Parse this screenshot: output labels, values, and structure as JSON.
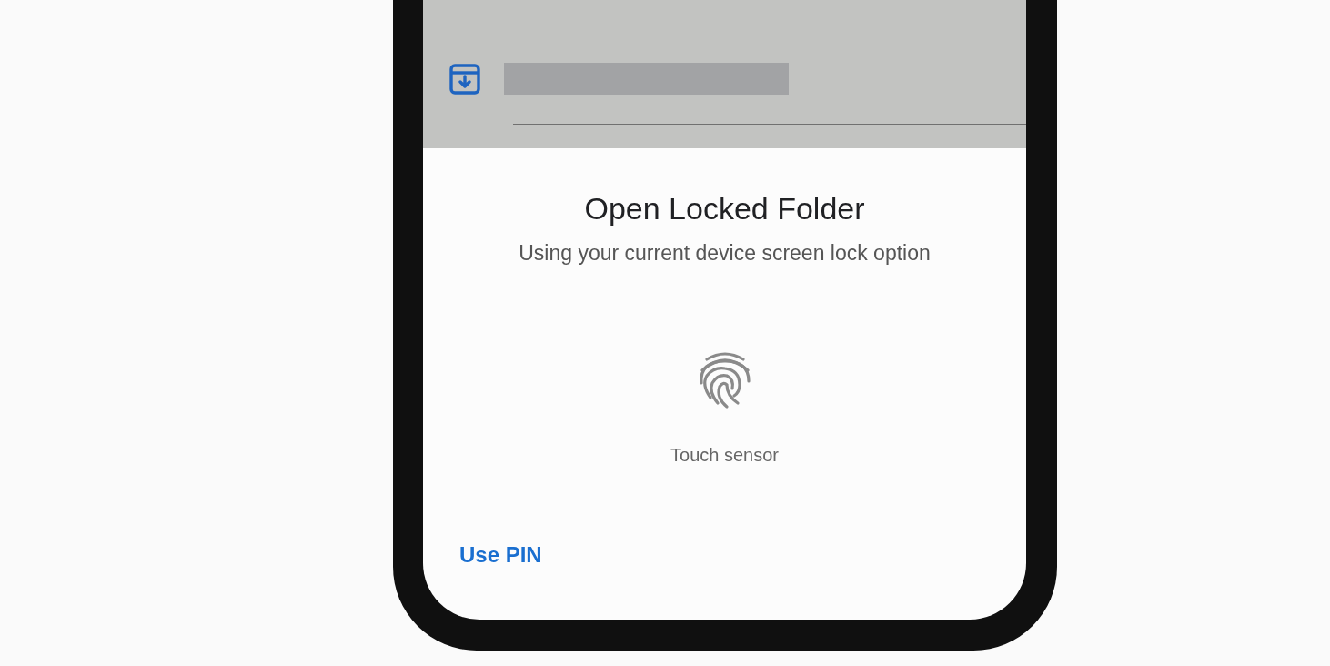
{
  "dialog": {
    "title": "Open Locked Folder",
    "subtitle": "Using your current device screen lock option",
    "sensor_label": "Touch sensor",
    "action": "Use PIN"
  }
}
